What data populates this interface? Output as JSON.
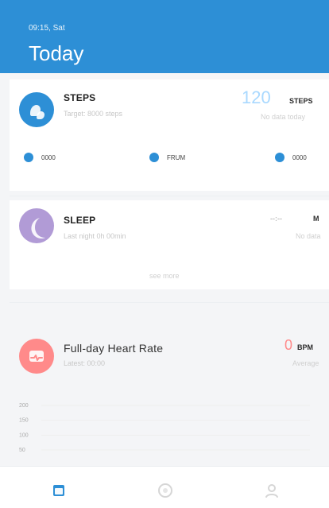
{
  "header": {
    "date": "09:15, Sat",
    "title": "Today"
  },
  "steps": {
    "label": "STEPS",
    "subtitle": "Target: 8000 steps",
    "value": "120",
    "unit": "STEPS",
    "note": "No data today",
    "minis": [
      {
        "label": "0000"
      },
      {
        "label": "FRUM"
      },
      {
        "label": "0000"
      }
    ]
  },
  "sleep": {
    "label": "SLEEP",
    "subtitle": "Last night 0h 00min",
    "value": "--:--",
    "unit": "M",
    "note": "No data",
    "see_more": "see more"
  },
  "heart": {
    "label": "Full-day Heart Rate",
    "subtitle": "Latest: 00:00",
    "value": "0",
    "unit": "BPM",
    "note": "Average"
  },
  "chart_data": {
    "type": "line",
    "y_ticks": [
      "200",
      "150",
      "100",
      "50"
    ],
    "ylim": [
      50,
      200
    ],
    "series": []
  },
  "tabs": [
    {
      "icon": "calendar-icon",
      "active": true
    },
    {
      "icon": "target-icon",
      "active": false
    },
    {
      "icon": "user-icon",
      "active": false
    }
  ],
  "colors": {
    "primary": "#2d8fd6",
    "steps_value": "#a9d9ff",
    "sleep_accent": "#b19bd6",
    "heart_accent": "#ff8a8a",
    "grid": "#eeeeee",
    "muted": "#cfcfcf"
  }
}
